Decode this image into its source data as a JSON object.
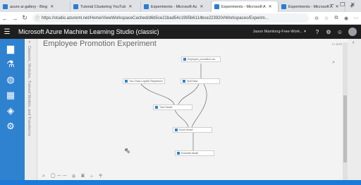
{
  "browser": {
    "tabs": [
      {
        "label": "azure ai gallery - Bing",
        "color": "#2b7cd3"
      },
      {
        "label": "Tutorial Clustering YouTub",
        "color": "#2b7cd3"
      },
      {
        "label": "Experiments - Microsoft Az",
        "color": "#2b7cd3"
      },
      {
        "label": "Experiments - Microsoft A",
        "color": "#2b7cd3",
        "active": true
      },
      {
        "label": "Experiments - Microsoft A",
        "color": "#2b7cd3"
      }
    ],
    "url": "https://studio.azureml.net/Home/ViewWorkspaceCached/d6b5ce21bad54c1995b6114bce223920#Workspaces/Experim..."
  },
  "app": {
    "title": "Microsoft Azure Machine Learning Studio (classic)",
    "workspace": "Jason Mamlong-Free-Work... ▾",
    "help_icon": "?",
    "settings_icon": "⚙",
    "smiley_icon": "☺"
  },
  "palette": {
    "label": "Datasets, Modules, Trained Models, and Transforms"
  },
  "experiment": {
    "title": "Employee Promotion Experiment",
    "status": "In draft",
    "modules": [
      {
        "label": "Employee_promotion.csv"
      },
      {
        "label": "Two-Class Logistic Regression"
      },
      {
        "label": "Split Data"
      },
      {
        "label": "Train Model"
      },
      {
        "label": "Score Model"
      },
      {
        "label": "Evaluate Model"
      }
    ]
  },
  "colors": {
    "nav_blue": "#2f82d0",
    "header_dark": "#1e1e1e"
  }
}
